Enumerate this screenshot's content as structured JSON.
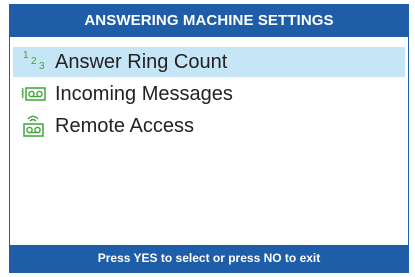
{
  "header": {
    "title": "ANSWERING MACHINE SETTINGS"
  },
  "menu": {
    "items": [
      {
        "label": "Answer Ring Count",
        "icon": "ring-count-icon",
        "selected": true
      },
      {
        "label": "Incoming Messages",
        "icon": "incoming-messages-icon",
        "selected": false
      },
      {
        "label": "Remote Access",
        "icon": "remote-access-icon",
        "selected": false
      }
    ],
    "ring_icon_digits": [
      "1",
      "2",
      "3"
    ]
  },
  "footer": {
    "hint": "Press YES to select or press NO to exit"
  },
  "colors": {
    "title_bar": "#1e5ea8",
    "selection": "#c6e6f7",
    "icon_green": "#3fa535"
  }
}
